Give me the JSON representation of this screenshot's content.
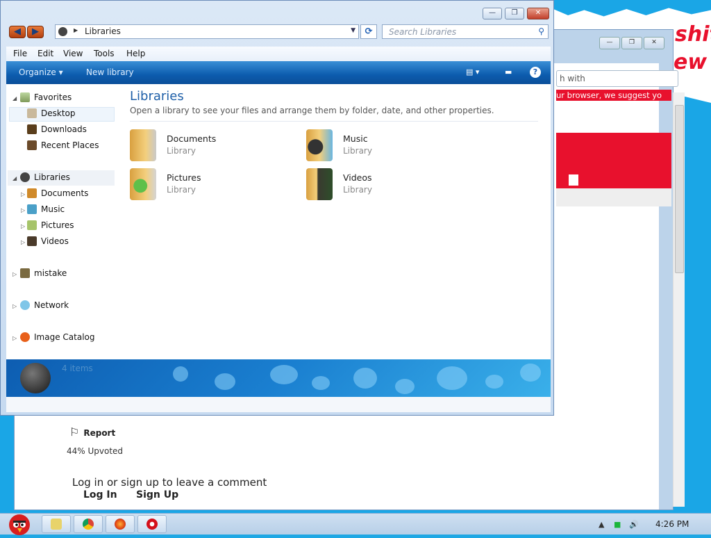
{
  "window": {
    "minimize": "—",
    "maximize": "❐",
    "close": "✕",
    "address": "Libraries",
    "search_placeholder": "Search Libraries"
  },
  "menu": [
    "File",
    "Edit",
    "View",
    "Tools",
    "Help"
  ],
  "commands": {
    "organize": "Organize ▾",
    "new_library": "New library"
  },
  "nav": {
    "favorites": "Favorites",
    "favorites_items": [
      "Desktop",
      "Downloads",
      "Recent Places"
    ],
    "libraries": "Libraries",
    "libraries_items": [
      "Documents",
      "Music",
      "Pictures",
      "Videos"
    ],
    "mistake": "mistake",
    "network": "Network",
    "image_catalog": "Image Catalog"
  },
  "main": {
    "title": "Libraries",
    "subtitle": "Open a library to see your files and arrange them by folder, date, and other properties.",
    "libraries": [
      {
        "name": "Documents",
        "type": "Library"
      },
      {
        "name": "Music",
        "type": "Library"
      },
      {
        "name": "Pictures",
        "type": "Library"
      },
      {
        "name": "Videos",
        "type": "Library"
      }
    ]
  },
  "details": {
    "items": "4 items"
  },
  "background": {
    "paper_text_1": "shit",
    "paper_text_2": "ew",
    "search_partial": "h with",
    "red_banner": "ur browser, we suggest yo",
    "report": "Report",
    "upvoted": "44% Upvoted",
    "login_prompt": "Log in or sign up to leave a comment",
    "login": "Log In",
    "signup": "Sign Up"
  },
  "taskbar": {
    "time": "4:26 PM"
  }
}
